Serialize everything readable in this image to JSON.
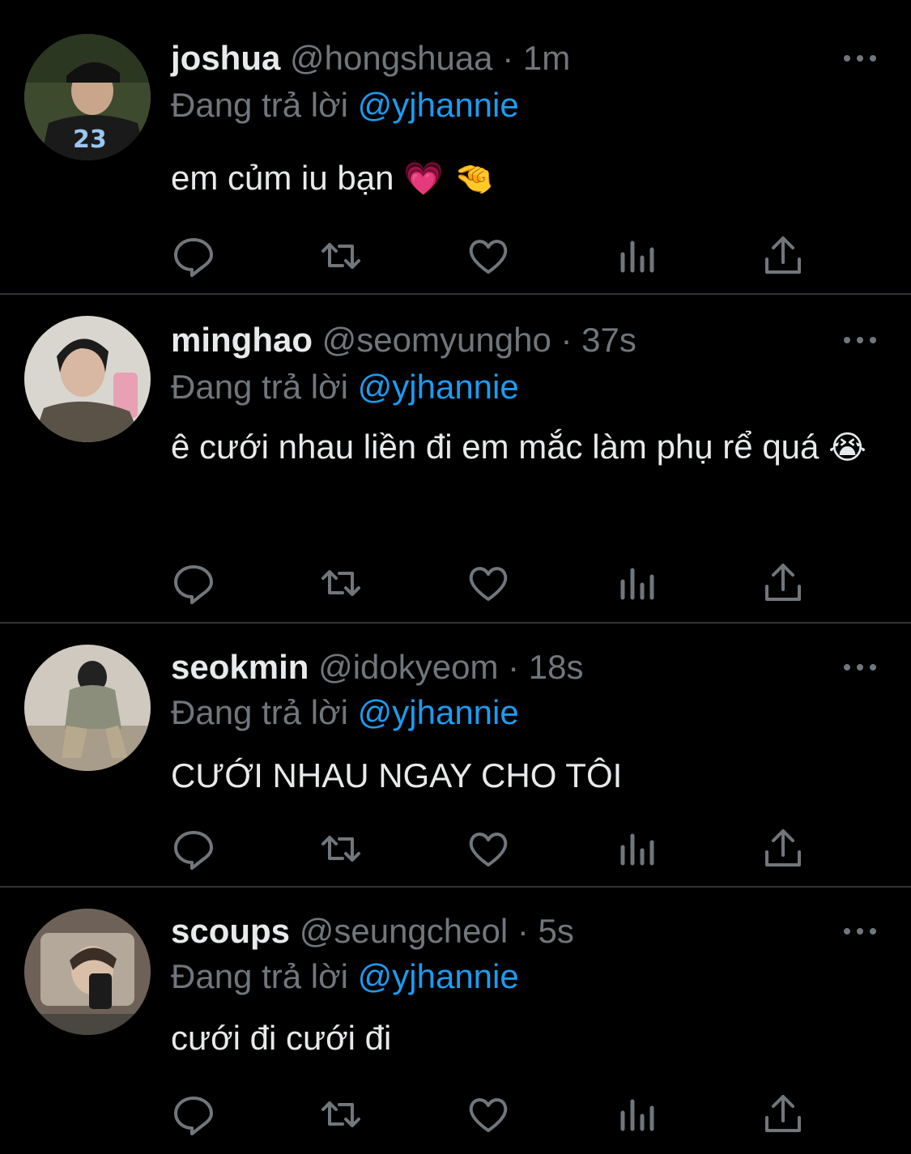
{
  "tweets": [
    {
      "name": "joshua",
      "handle": "@hongshuaa",
      "separator": " · ",
      "time": "1m",
      "reply_prefix": "Đang trả lời ",
      "reply_to": "@yjhannie",
      "text": "em củm iu bạn",
      "emoji": "💗 🤏"
    },
    {
      "name": "minghao",
      "handle": "@seomyungho",
      "separator": " · ",
      "time": "37s",
      "reply_prefix": "Đang trả lời ",
      "reply_to": "@yjhannie",
      "text": "ê cưới nhau liền đi em mắc làm phụ rể quá",
      "emoji": "😭"
    },
    {
      "name": "seokmin",
      "handle": "@idokyeom",
      "separator": " · ",
      "time": "18s",
      "reply_prefix": "Đang trả lời ",
      "reply_to": "@yjhannie",
      "text": "CƯỚI NHAU NGAY CHO TÔI",
      "emoji": ""
    },
    {
      "name": "scoups",
      "handle": "@seungcheol",
      "separator": " · ",
      "time": "5s",
      "reply_prefix": "Đang trả lời ",
      "reply_to": "@yjhannie",
      "text": "cưới đi cưới đi",
      "emoji": ""
    }
  ],
  "icons": {
    "more": "more-horizontal-icon",
    "reply": "reply-icon",
    "retweet": "retweet-icon",
    "like": "like-icon",
    "views": "views-icon",
    "share": "share-icon"
  },
  "colors": {
    "background": "#000000",
    "text": "#e7e9ea",
    "muted": "#71767b",
    "mention": "#1d9bf0",
    "divider": "#2f3336"
  }
}
